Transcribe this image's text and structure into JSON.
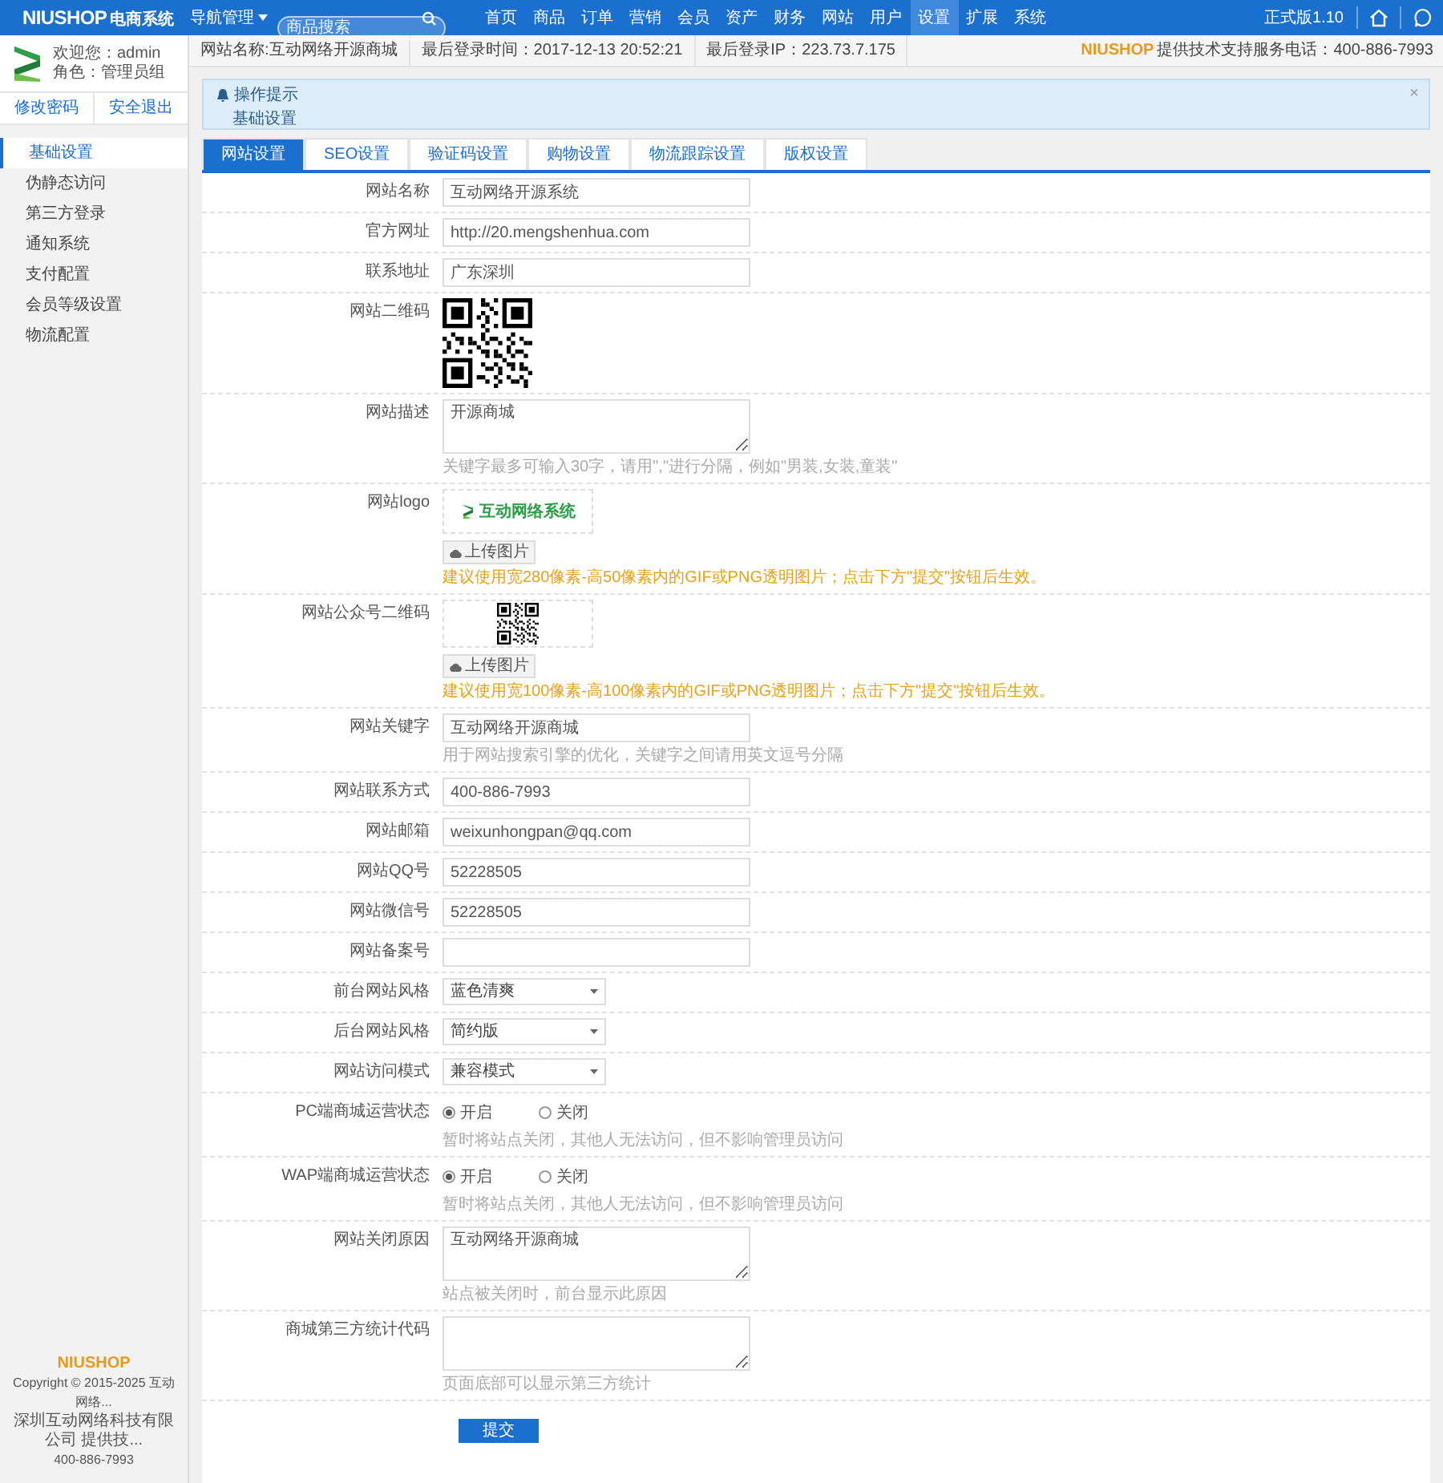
{
  "top_bar": {
    "brand": "NIUSHOP",
    "brand_suffix": "电商系统",
    "nav_dropdown": "导航管理",
    "search": {
      "placeholder": "商品搜索"
    },
    "nav": [
      {
        "label": "首页",
        "selected": false
      },
      {
        "label": "商品",
        "selected": false
      },
      {
        "label": "订单",
        "selected": false
      },
      {
        "label": "营销",
        "selected": false
      },
      {
        "label": "会员",
        "selected": false
      },
      {
        "label": "资产",
        "selected": false
      },
      {
        "label": "财务",
        "selected": false
      },
      {
        "label": "网站",
        "selected": false
      },
      {
        "label": "用户",
        "selected": false
      },
      {
        "label": "设置",
        "selected": true
      },
      {
        "label": "扩展",
        "selected": false
      },
      {
        "label": "系统",
        "selected": false
      }
    ],
    "version": "正式版1.10"
  },
  "sidebar": {
    "welcome": "欢迎您：admin",
    "role": "角色：管理员组",
    "buttons": [
      "修改密码",
      "安全退出"
    ],
    "items": [
      {
        "label": "基础设置",
        "selected": true
      },
      {
        "label": "伪静态访问",
        "selected": false
      },
      {
        "label": "第三方登录",
        "selected": false
      },
      {
        "label": "通知系统",
        "selected": false
      },
      {
        "label": "支付配置",
        "selected": false
      },
      {
        "label": "会员等级设置",
        "selected": false
      },
      {
        "label": "物流配置",
        "selected": false
      }
    ],
    "footer": {
      "brand": "NIUSHOP",
      "copyright": "Copyright © 2015-2025 互动网络...",
      "company": "深圳互动网络科技有限公司 提供技...",
      "phone": "400-886-7993"
    }
  },
  "info_bar": {
    "items": [
      "网站名称:互动网络开源商城",
      "最后登录时间：2017-12-13 20:52:21",
      "最后登录IP：223.73.7.175"
    ],
    "brand": "NIUSHOP",
    "support": "提供技术支持服务电话：400-886-7993"
  },
  "notice": {
    "title": "操作提示",
    "text": "基础设置",
    "close": "×"
  },
  "tabs": [
    {
      "label": "网站设置",
      "selected": true
    },
    {
      "label": "SEO设置",
      "selected": false
    },
    {
      "label": "验证码设置",
      "selected": false
    },
    {
      "label": "购物设置",
      "selected": false
    },
    {
      "label": "物流跟踪设置",
      "selected": false
    },
    {
      "label": "版权设置",
      "selected": false
    }
  ],
  "form": {
    "rows": [
      {
        "kind": "text",
        "label": "网站名称",
        "value": "互动网络开源系统"
      },
      {
        "kind": "text",
        "label": "官方网址",
        "value": "http://20.mengshenhua.com"
      },
      {
        "kind": "text",
        "label": "联系地址",
        "value": "广东深圳"
      },
      {
        "kind": "qr",
        "label": "网站二维码"
      },
      {
        "kind": "textarea",
        "label": "网站描述",
        "value": "开源商城",
        "hint": "关键字最多可输入30字，请用\",\"进行分隔，例如\"男装,女装,童装\"",
        "warning": false
      },
      {
        "kind": "logo_upload",
        "label": "网站logo",
        "logo_text": "互动网络系统",
        "button": "上传图片",
        "hint": "建议使用宽280像素-高50像素内的GIF或PNG透明图片；点击下方\"提交\"按钮后生效。",
        "warning": true
      },
      {
        "kind": "qr_upload",
        "label": "网站公众号二维码",
        "button": "上传图片",
        "hint": "建议使用宽100像素-高100像素内的GIF或PNG透明图片；点击下方\"提交\"按钮后生效。",
        "warning": true
      },
      {
        "kind": "text",
        "label": "网站关键字",
        "value": "互动网络开源商城",
        "hint": "用于网站搜索引擎的优化，关键字之间请用英文逗号分隔",
        "warning": false
      },
      {
        "kind": "text",
        "label": "网站联系方式",
        "value": "400-886-7993"
      },
      {
        "kind": "text",
        "label": "网站邮箱",
        "value": "weixunhongpan@qq.com"
      },
      {
        "kind": "text",
        "label": "网站QQ号",
        "value": "52228505"
      },
      {
        "kind": "text",
        "label": "网站微信号",
        "value": "52228505"
      },
      {
        "kind": "text",
        "label": "网站备案号"
      },
      {
        "kind": "select",
        "label": "前台网站风格",
        "value": "蓝色清爽"
      },
      {
        "kind": "select",
        "label": "后台网站风格",
        "value": "简约版"
      },
      {
        "kind": "select",
        "label": "网站访问模式",
        "value": "兼容模式"
      },
      {
        "kind": "radio",
        "label": "PC端商城运营状态",
        "options": [
          {
            "label": "开启",
            "selected": true
          },
          {
            "label": "关闭",
            "selected": false
          }
        ],
        "hint": "暂时将站点关闭，其他人无法访问，但不影响管理员访问",
        "warning": false
      },
      {
        "kind": "radio",
        "label": "WAP端商城运营状态",
        "options": [
          {
            "label": "开启",
            "selected": true
          },
          {
            "label": "关闭",
            "selected": false
          }
        ],
        "hint": "暂时将站点关闭，其他人无法访问，但不影响管理员访问",
        "warning": false
      },
      {
        "kind": "textarea",
        "label": "网站关闭原因",
        "value": "互动网络开源商城",
        "hint": "站点被关闭时，前台显示此原因",
        "warning": false
      },
      {
        "kind": "textarea",
        "label": "商城第三方统计代码",
        "hint": "页面底部可以显示第三方统计",
        "warning": false
      }
    ],
    "submit": "提交"
  }
}
